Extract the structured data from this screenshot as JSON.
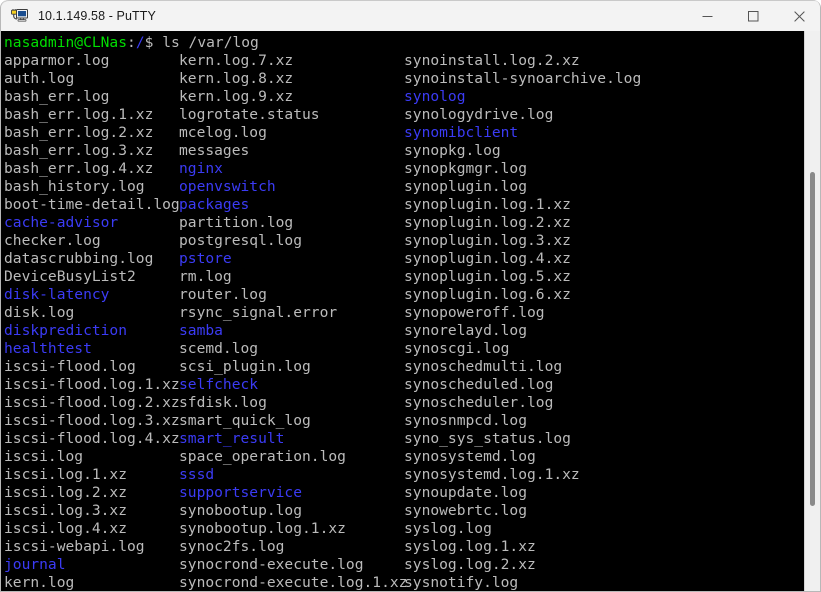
{
  "window": {
    "title": "10.1.149.58 - PuTTY",
    "icon": "putty-icon",
    "minimize_label": "Minimize",
    "maximize_label": "Maximize",
    "close_label": "Close"
  },
  "terminal": {
    "prompt": {
      "user_host": "nasadmin@CLNas",
      "colon": ":",
      "path": "/",
      "sigil": "$",
      "command": " ls /var/log"
    },
    "colors": {
      "background": "#000000",
      "foreground": "#bbbbbb",
      "green": "#00dd00",
      "blue": "#3b3bf5"
    },
    "columns": [
      [
        {
          "name": "apparmor.log",
          "type": "file"
        },
        {
          "name": "auth.log",
          "type": "file"
        },
        {
          "name": "bash_err.log",
          "type": "file"
        },
        {
          "name": "bash_err.log.1.xz",
          "type": "file"
        },
        {
          "name": "bash_err.log.2.xz",
          "type": "file"
        },
        {
          "name": "bash_err.log.3.xz",
          "type": "file"
        },
        {
          "name": "bash_err.log.4.xz",
          "type": "file"
        },
        {
          "name": "bash_history.log",
          "type": "file"
        },
        {
          "name": "boot-time-detail.log",
          "type": "file"
        },
        {
          "name": "cache-advisor",
          "type": "dir"
        },
        {
          "name": "checker.log",
          "type": "file"
        },
        {
          "name": "datascrubbing.log",
          "type": "file"
        },
        {
          "name": "DeviceBusyList2",
          "type": "file"
        },
        {
          "name": "disk-latency",
          "type": "dir"
        },
        {
          "name": "disk.log",
          "type": "file"
        },
        {
          "name": "diskprediction",
          "type": "dir"
        },
        {
          "name": "healthtest",
          "type": "dir"
        },
        {
          "name": "iscsi-flood.log",
          "type": "file"
        },
        {
          "name": "iscsi-flood.log.1.xz",
          "type": "file"
        },
        {
          "name": "iscsi-flood.log.2.xz",
          "type": "file"
        },
        {
          "name": "iscsi-flood.log.3.xz",
          "type": "file"
        },
        {
          "name": "iscsi-flood.log.4.xz",
          "type": "file"
        },
        {
          "name": "iscsi.log",
          "type": "file"
        },
        {
          "name": "iscsi.log.1.xz",
          "type": "file"
        },
        {
          "name": "iscsi.log.2.xz",
          "type": "file"
        },
        {
          "name": "iscsi.log.3.xz",
          "type": "file"
        },
        {
          "name": "iscsi.log.4.xz",
          "type": "file"
        },
        {
          "name": "iscsi-webapi.log",
          "type": "file"
        },
        {
          "name": "journal",
          "type": "dir"
        },
        {
          "name": "kern.log",
          "type": "file"
        }
      ],
      [
        {
          "name": "kern.log.7.xz",
          "type": "file"
        },
        {
          "name": "kern.log.8.xz",
          "type": "file"
        },
        {
          "name": "kern.log.9.xz",
          "type": "file"
        },
        {
          "name": "logrotate.status",
          "type": "file"
        },
        {
          "name": "mcelog.log",
          "type": "file"
        },
        {
          "name": "messages",
          "type": "file"
        },
        {
          "name": "nginx",
          "type": "dir"
        },
        {
          "name": "openvswitch",
          "type": "dir"
        },
        {
          "name": "packages",
          "type": "dir"
        },
        {
          "name": "partition.log",
          "type": "file"
        },
        {
          "name": "postgresql.log",
          "type": "file"
        },
        {
          "name": "pstore",
          "type": "dir"
        },
        {
          "name": "rm.log",
          "type": "file"
        },
        {
          "name": "router.log",
          "type": "file"
        },
        {
          "name": "rsync_signal.error",
          "type": "file"
        },
        {
          "name": "samba",
          "type": "dir"
        },
        {
          "name": "scemd.log",
          "type": "file"
        },
        {
          "name": "scsi_plugin.log",
          "type": "file"
        },
        {
          "name": "selfcheck",
          "type": "dir"
        },
        {
          "name": "sfdisk.log",
          "type": "file"
        },
        {
          "name": "smart_quick_log",
          "type": "file"
        },
        {
          "name": "smart_result",
          "type": "dir"
        },
        {
          "name": "space_operation.log",
          "type": "file"
        },
        {
          "name": "sssd",
          "type": "dir"
        },
        {
          "name": "supportservice",
          "type": "dir"
        },
        {
          "name": "synobootup.log",
          "type": "file"
        },
        {
          "name": "synobootup.log.1.xz",
          "type": "file"
        },
        {
          "name": "synoc2fs.log",
          "type": "file"
        },
        {
          "name": "synocrond-execute.log",
          "type": "file"
        },
        {
          "name": "synocrond-execute.log.1.xz",
          "type": "file"
        }
      ],
      [
        {
          "name": "synoinstall.log.2.xz",
          "type": "file"
        },
        {
          "name": "synoinstall-synoarchive.log",
          "type": "file"
        },
        {
          "name": "synolog",
          "type": "dir"
        },
        {
          "name": "synologydrive.log",
          "type": "file"
        },
        {
          "name": "synomibclient",
          "type": "dir"
        },
        {
          "name": "synopkg.log",
          "type": "file"
        },
        {
          "name": "synopkgmgr.log",
          "type": "file"
        },
        {
          "name": "synoplugin.log",
          "type": "file"
        },
        {
          "name": "synoplugin.log.1.xz",
          "type": "file"
        },
        {
          "name": "synoplugin.log.2.xz",
          "type": "file"
        },
        {
          "name": "synoplugin.log.3.xz",
          "type": "file"
        },
        {
          "name": "synoplugin.log.4.xz",
          "type": "file"
        },
        {
          "name": "synoplugin.log.5.xz",
          "type": "file"
        },
        {
          "name": "synoplugin.log.6.xz",
          "type": "file"
        },
        {
          "name": "synopoweroff.log",
          "type": "file"
        },
        {
          "name": "synorelayd.log",
          "type": "file"
        },
        {
          "name": "synoscgi.log",
          "type": "file"
        },
        {
          "name": "synoschedmulti.log",
          "type": "file"
        },
        {
          "name": "synoscheduled.log",
          "type": "file"
        },
        {
          "name": "synoscheduler.log",
          "type": "file"
        },
        {
          "name": "synosnmpcd.log",
          "type": "file"
        },
        {
          "name": "syno_sys_status.log",
          "type": "file"
        },
        {
          "name": "synosystemd.log",
          "type": "file"
        },
        {
          "name": "synosystemd.log.1.xz",
          "type": "file"
        },
        {
          "name": "synoupdate.log",
          "type": "file"
        },
        {
          "name": "synowebrtc.log",
          "type": "file"
        },
        {
          "name": "syslog.log",
          "type": "file"
        },
        {
          "name": "syslog.log.1.xz",
          "type": "file"
        },
        {
          "name": "syslog.log.2.xz",
          "type": "file"
        },
        {
          "name": "sysnotify.log",
          "type": "file"
        }
      ]
    ]
  },
  "scrollbar": {
    "name": "vertical-scrollbar"
  }
}
